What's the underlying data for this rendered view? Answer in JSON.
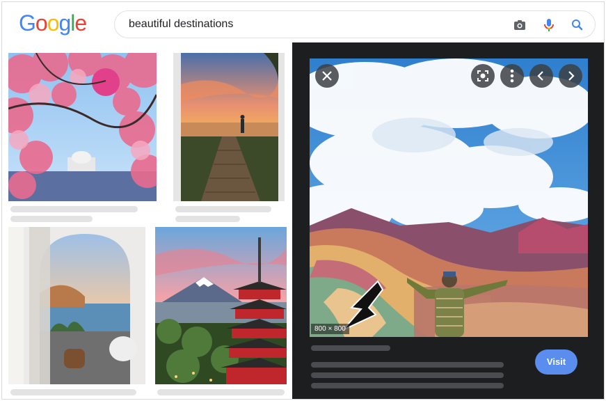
{
  "search": {
    "query": "beautiful destinations"
  },
  "logo": {
    "letters": [
      "G",
      "o",
      "o",
      "g",
      "l",
      "e"
    ],
    "colors": [
      "#4285F4",
      "#EA4335",
      "#FBBC05",
      "#4285F4",
      "#34A853",
      "#EA4335"
    ]
  },
  "icons": {
    "camera": "camera-icon",
    "mic": "microphone-icon",
    "search": "search-icon",
    "close": "close-icon",
    "lens": "lens-icon",
    "more": "more-vert-icon",
    "prev": "chevron-left-icon",
    "next": "chevron-right-icon"
  },
  "preview": {
    "dimensions": "800 × 800",
    "visit_label": "Visit"
  },
  "colors": {
    "search_accent": "#4285F4",
    "panel_bg": "#1d1e20",
    "visit_button": "#5b8def"
  }
}
